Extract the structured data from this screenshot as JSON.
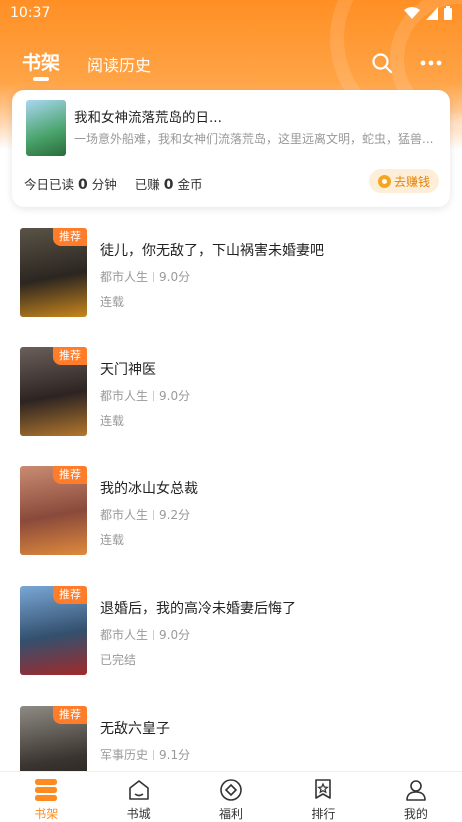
{
  "status_bar": {
    "time": "10:37"
  },
  "nav": {
    "tab_active": "书架",
    "tab_inactive": "阅读历史"
  },
  "reading_card": {
    "title": "我和女神流落荒岛的日...",
    "description": "一场意外船难，我和女神们流落荒岛，这里远离文明，蛇虫，猛兽...",
    "today_label": "今日已读",
    "today_value": "0",
    "today_unit": "分钟",
    "earned_label": "已赚",
    "earned_value": "0",
    "earned_unit": "金币",
    "earn_button": "去赚钱"
  },
  "books": [
    {
      "title": "徒儿，你无敌了，下山祸害未婚妻吧",
      "category": "都市人生",
      "score": "9.0分",
      "status": "连载",
      "badge": "推荐"
    },
    {
      "title": "天门神医",
      "category": "都市人生",
      "score": "9.0分",
      "status": "连载",
      "badge": "推荐"
    },
    {
      "title": "我的冰山女总裁",
      "category": "都市人生",
      "score": "9.2分",
      "status": "连载",
      "badge": "推荐"
    },
    {
      "title": "退婚后，我的高冷未婚妻后悔了",
      "category": "都市人生",
      "score": "9.0分",
      "status": "已完结",
      "badge": "推荐"
    },
    {
      "title": "无敌六皇子",
      "category": "军事历史",
      "score": "9.1分",
      "status": "",
      "badge": "推荐"
    }
  ],
  "tabbar": [
    {
      "label": "书架",
      "icon": "bookshelf-icon",
      "active": true
    },
    {
      "label": "书城",
      "icon": "store-icon",
      "active": false
    },
    {
      "label": "福利",
      "icon": "gift-icon",
      "active": false
    },
    {
      "label": "排行",
      "icon": "ranking-icon",
      "active": false
    },
    {
      "label": "我的",
      "icon": "profile-icon",
      "active": false
    }
  ],
  "colors": {
    "accent": "#ff8a1f",
    "badge": "#ff7d2a"
  }
}
